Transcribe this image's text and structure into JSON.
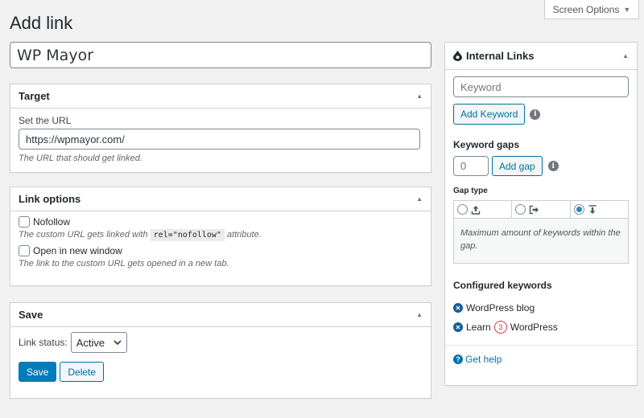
{
  "screen_options": {
    "label": "Screen Options"
  },
  "page": {
    "title": "Add link",
    "title_value": "WP Mayor"
  },
  "target_box": {
    "title": "Target",
    "url_label": "Set the URL",
    "url_value": "https://wpmayor.com/",
    "description": "The URL that should get linked."
  },
  "link_options_box": {
    "title": "Link options",
    "nofollow_label": "Nofollow",
    "nofollow_desc_before": "The custom URL gets linked with",
    "nofollow_code": "rel=\"nofollow\"",
    "nofollow_desc_after": "attribute.",
    "new_window_label": "Open in new window",
    "new_window_desc": "The link to the custom URL gets opened in a new tab."
  },
  "save_box": {
    "title": "Save",
    "status_label": "Link status:",
    "status_value": "Active",
    "save_button": "Save",
    "delete_button": "Delete"
  },
  "internal_links": {
    "title": "Internal Links",
    "keyword_placeholder": "Keyword",
    "add_keyword_button": "Add Keyword",
    "keyword_gaps_label": "Keyword gaps",
    "gap_value": "0",
    "add_gap_button": "Add gap",
    "gap_type_label": "Gap type",
    "gap_types": [
      {
        "icon": "upload-icon",
        "selected": false
      },
      {
        "icon": "exit-icon",
        "selected": false
      },
      {
        "icon": "download-icon",
        "selected": true
      }
    ],
    "gap_description": "Maximum amount of keywords within the gap.",
    "configured_keywords_label": "Configured keywords",
    "keyword_1": "WordPress blog",
    "keyword_2_before": "Learn",
    "keyword_2_gap": "3",
    "keyword_2_after": "WordPress",
    "help_link": "Get help"
  },
  "colors": {
    "primary": "#007cba",
    "link": "#0073aa",
    "badge": "#d63638"
  }
}
